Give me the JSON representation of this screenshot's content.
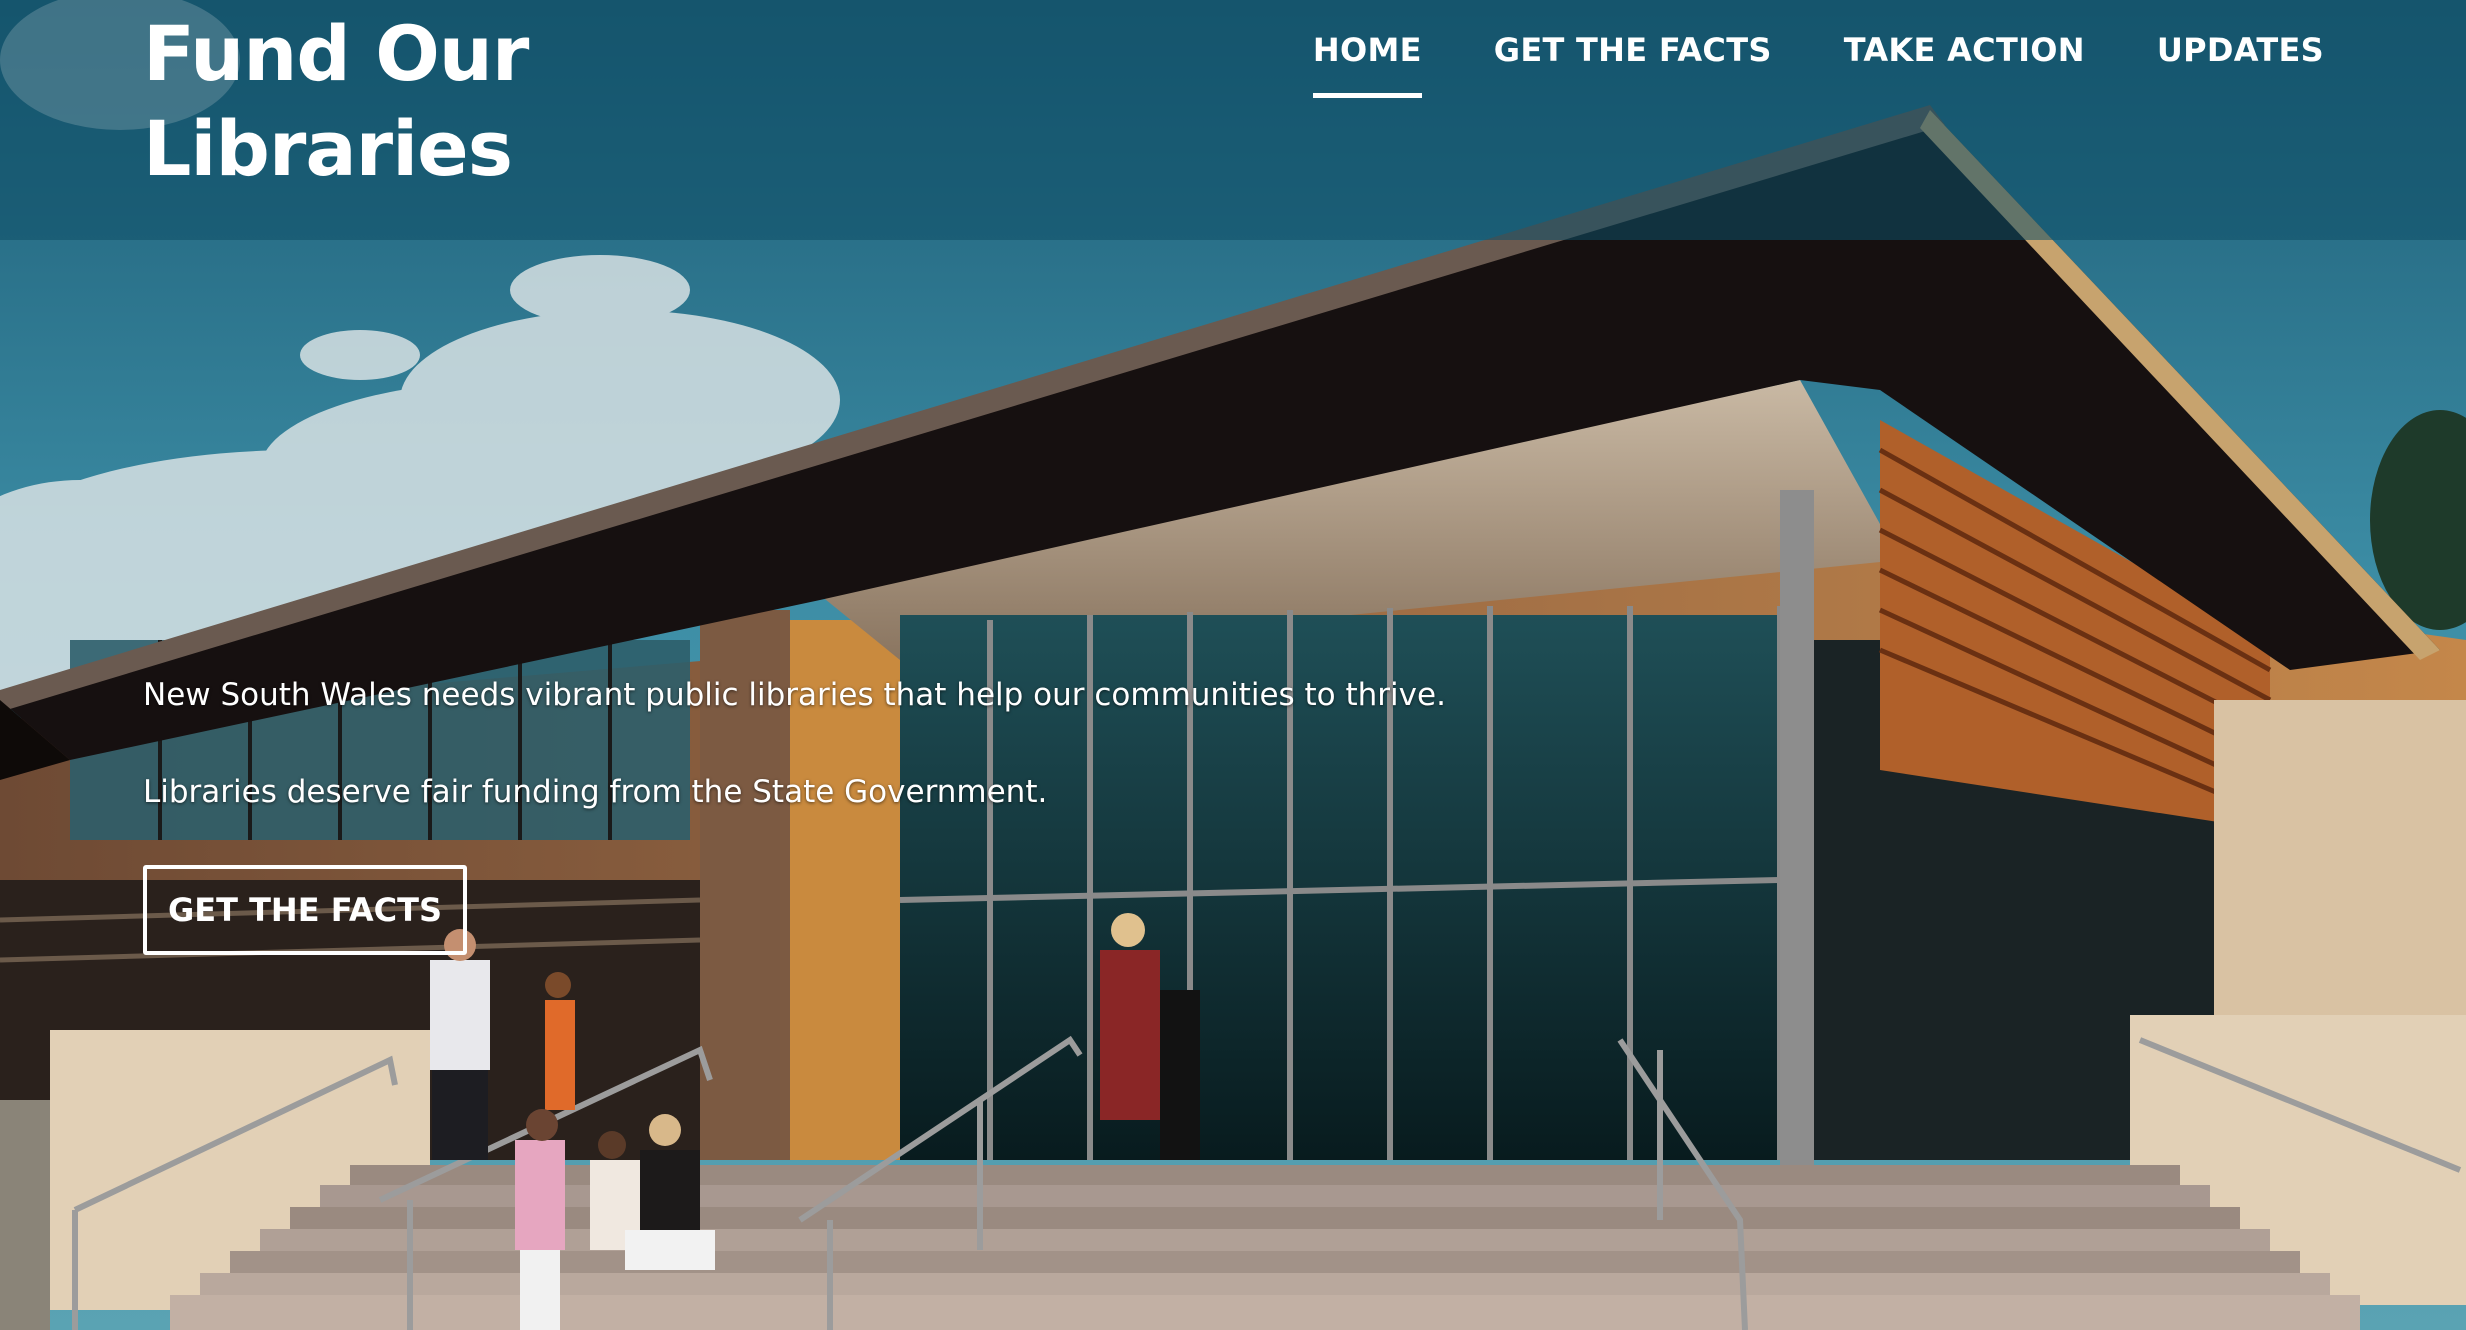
{
  "site": {
    "title_line1": "Fund Our",
    "title_line2": "Libraries"
  },
  "nav": {
    "items": [
      {
        "label": "HOME",
        "active": true
      },
      {
        "label": "GET THE FACTS",
        "active": false
      },
      {
        "label": "TAKE ACTION",
        "active": false
      },
      {
        "label": "UPDATES",
        "active": false
      }
    ]
  },
  "hero": {
    "line1": "New South Wales needs vibrant public libraries that help our communities to thrive.",
    "line2": "Libraries deserve fair funding from the State Government.",
    "cta_label": "GET THE FACTS",
    "image": "library-building-photo"
  },
  "colors": {
    "header_overlay": "#0e4e66",
    "sky": "#2b7a93",
    "roof": "#1c1410",
    "glass": "#0e2a2e",
    "text": "#ffffff"
  }
}
